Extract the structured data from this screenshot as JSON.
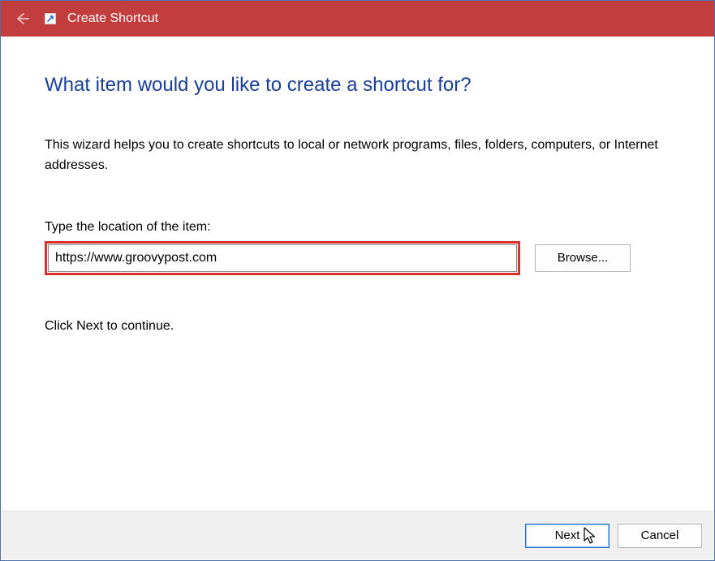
{
  "titlebar": {
    "title": "Create Shortcut"
  },
  "wizard": {
    "heading": "What item would you like to create a shortcut for?",
    "description": "This wizard helps you to create shortcuts to local or network programs, files, folders, computers, or Internet addresses.",
    "location_label": "Type the location of the item:",
    "location_value": "https://www.groovypost.com",
    "browse_label": "Browse...",
    "continue_hint": "Click Next to continue."
  },
  "footer": {
    "next_label": "Next",
    "cancel_label": "Cancel"
  }
}
